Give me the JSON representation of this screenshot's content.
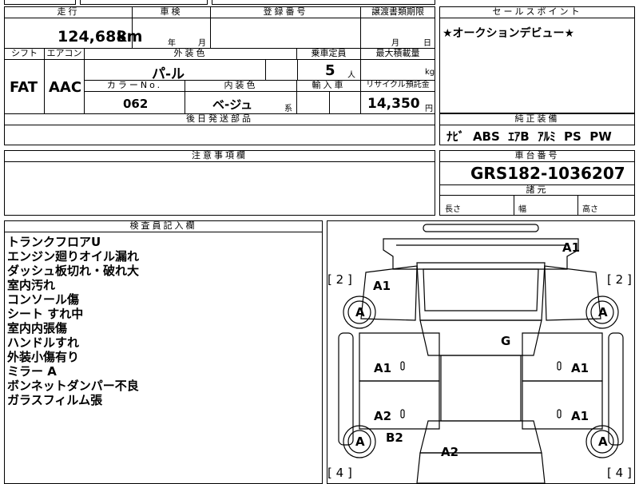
{
  "top_fragment": "",
  "mileage": {
    "label": "走行",
    "value": "124,688",
    "unit": "km"
  },
  "inspection": {
    "label": "車検",
    "year_unit": "年",
    "month_unit": "月"
  },
  "registration": {
    "label": "登録番号"
  },
  "transfer_deadline": {
    "label": "譲渡書類期限",
    "month_unit": "月",
    "day_unit": "日"
  },
  "sales_point": {
    "label": "セールスポイント",
    "text": "★オークションデビュー★"
  },
  "shift": {
    "label": "シフト",
    "value": "FAT"
  },
  "aircon": {
    "label": "エアコン",
    "value": "AAC"
  },
  "exterior_color": {
    "label": "外装色",
    "value": "パ-ル"
  },
  "capacity": {
    "label": "乗車定員",
    "value": "5",
    "unit": "人"
  },
  "max_load": {
    "label": "最大積載量",
    "unit": "kg"
  },
  "color_no": {
    "label": "カラーNo.",
    "value": "062"
  },
  "interior_color": {
    "label": "内装色",
    "value": "ベ-ジュ",
    "suffix": "系"
  },
  "import_car": {
    "label": "輸入車"
  },
  "recycle_fee": {
    "label": "リサイクル預託金",
    "value": "14,350",
    "unit": "円"
  },
  "later_parts": {
    "label": "後日発送部品"
  },
  "factory_equipment": {
    "label": "純正装備",
    "value": "ﾅﾋﾞ  ABS  ｴｱB  ｱﾙﾐ  PS  PW"
  },
  "notes": {
    "label": "注意事項欄"
  },
  "chassis_no": {
    "label": "車台番号",
    "value": "GRS182-1036207"
  },
  "dimensions": {
    "label": "諸元",
    "length": "長さ",
    "width": "幅",
    "height": "高さ"
  },
  "inspector": {
    "label": "検査員記入欄",
    "remarks": [
      "トランクフロアU",
      "エンジン廻りオイル漏れ",
      "ダッシュ板切れ・破れ大",
      "室内汚れ",
      "コンソール傷",
      "シート すれ中",
      "室内内張傷",
      "ハンドルすれ",
      "外装小傷有り",
      "ミラー A",
      "ボンネットダンパー不良",
      "ガラスフィルム張"
    ]
  },
  "diagram": {
    "tire_left_top": "2",
    "tire_right_top": "2",
    "tire_left_bottom": "4",
    "tire_right_bottom": "4",
    "marks": {
      "bumper_front": "A1",
      "fender_front_left": "A1",
      "wheel_fl": "A",
      "wheel_fr": "A",
      "wheel_rl": "A",
      "wheel_rr": "A",
      "glass": "G",
      "door_fl": "A1",
      "door_fr": "A1",
      "door_rl": "A2",
      "door_rr": "A1",
      "quarter_rl": "B2",
      "trunk": "A2"
    }
  }
}
